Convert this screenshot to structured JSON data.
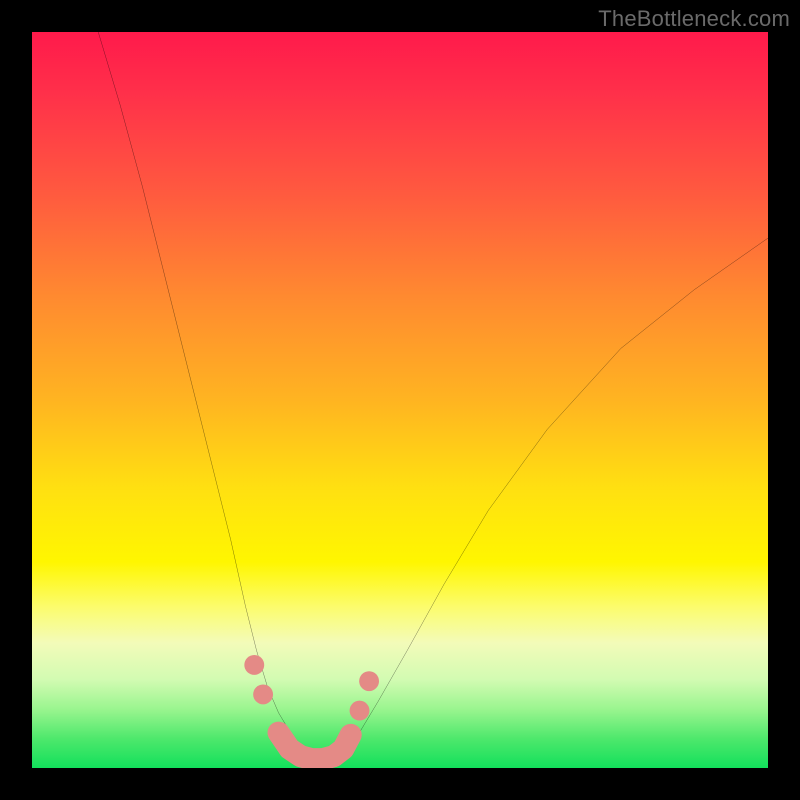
{
  "watermark": "TheBottleneck.com",
  "chart_data": {
    "type": "line",
    "title": "",
    "xlabel": "",
    "ylabel": "",
    "xlim": [
      0,
      100
    ],
    "ylim": [
      0,
      100
    ],
    "series": [
      {
        "name": "left-curve",
        "x": [
          9,
          12,
          15,
          18,
          21,
          24,
          27,
          29,
          30.5,
          32,
          33.5,
          35,
          36,
          37,
          38
        ],
        "values": [
          100,
          90,
          79,
          67,
          55,
          43,
          31,
          22,
          16,
          11,
          7.5,
          5,
          3.5,
          2.3,
          1.5
        ]
      },
      {
        "name": "right-curve",
        "x": [
          42,
          44,
          47,
          51,
          56,
          62,
          70,
          80,
          90,
          100
        ],
        "values": [
          1.5,
          4,
          9,
          16,
          25,
          35,
          46,
          57,
          65,
          72
        ]
      }
    ],
    "markers": {
      "style": "pink-dots-and-rounded-segment",
      "color": "#e48a86",
      "x": [
        30.2,
        31.4,
        33.5,
        35.0,
        36.5,
        38.0,
        39.5,
        41.0,
        42.3,
        43.3,
        44.5,
        45.8
      ],
      "y": [
        14.0,
        10.0,
        4.8,
        2.6,
        1.6,
        1.2,
        1.2,
        1.6,
        2.6,
        4.5,
        7.8,
        11.8
      ]
    },
    "background": "vertical-gradient-red-to-green"
  }
}
